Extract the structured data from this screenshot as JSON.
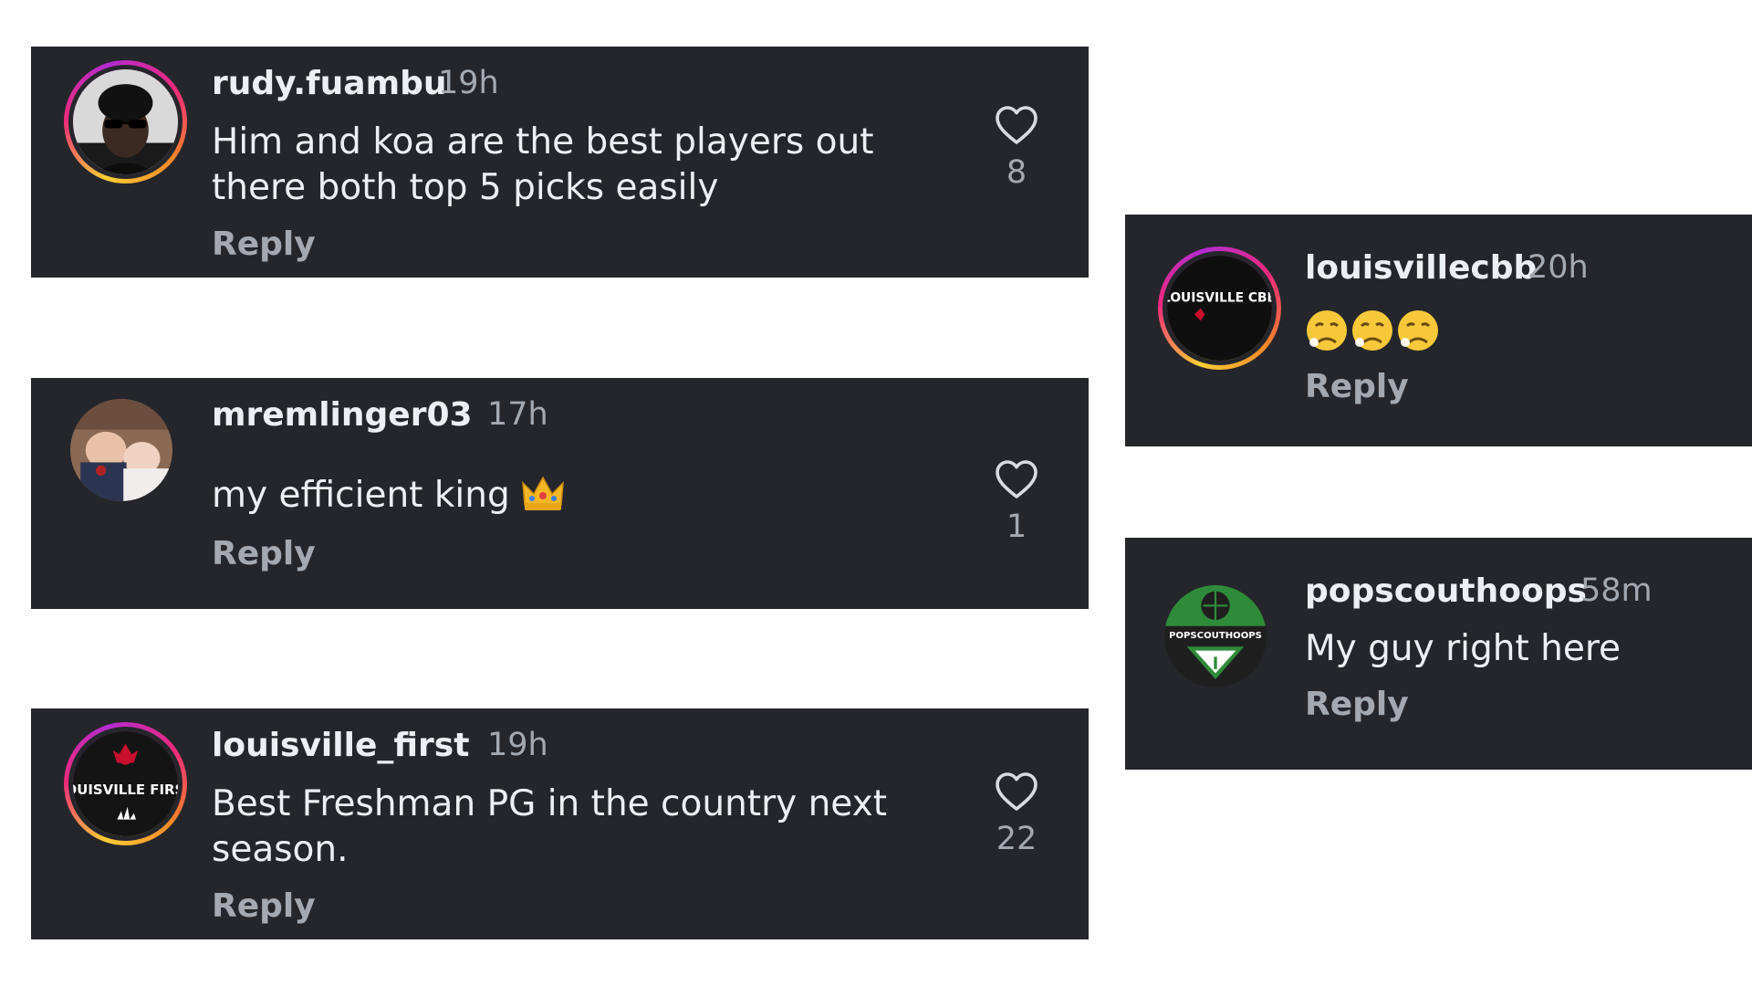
{
  "comments": [
    {
      "username": "rudy.fuambu",
      "time": "19h",
      "text": "Him and koa are the best players out there both top 5 picks easily",
      "reply": "Reply",
      "likes": "8",
      "icon": "heart-icon"
    },
    {
      "username": "mremlinger03",
      "time": "17h",
      "text": "my efficient king",
      "emoji": "crown",
      "reply": "Reply",
      "likes": "1",
      "icon": "heart-icon"
    },
    {
      "username": "louisville_first",
      "time": "19h",
      "text": "Best Freshman PG in the country next season.",
      "reply": "Reply",
      "likes": "22",
      "icon": "heart-icon",
      "avatar_text": "LOUISVILLE FIRST"
    },
    {
      "username": "louisvillecbb",
      "time": "20h",
      "emoji": "disappointed-face x3",
      "reply": "Reply",
      "avatar_text": "LOUISVILLE CBB"
    },
    {
      "username": "popscouthoops",
      "time": "58m",
      "text": "My guy right here",
      "reply": "Reply",
      "avatar_text": "POPSCOUTHOOPS"
    }
  ],
  "colors": {
    "card_bg": "#25262b",
    "text": "#eceff3",
    "muted": "#a4a9b1",
    "story_ring": "#ee2a7b"
  }
}
